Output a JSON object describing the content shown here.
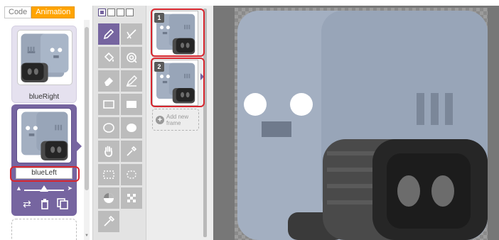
{
  "tabs": {
    "code": "Code",
    "animation": "Animation"
  },
  "animations": [
    {
      "name": "blueRight",
      "selected": false
    },
    {
      "name": "blueLeft",
      "selected": true
    }
  ],
  "speed": {
    "slow_icon": "turtle-icon",
    "fast_icon": "rabbit-icon",
    "level": 0.5
  },
  "card_actions": [
    "loop-icon",
    "trash-icon",
    "duplicate-icon"
  ],
  "tools": [
    "pencil-icon",
    "line-icon",
    "fill-bucket-icon",
    "lasso-select-icon",
    "eraser-icon",
    "pen-icon",
    "rectangle-outline-icon",
    "rectangle-filled-icon",
    "ellipse-outline-icon",
    "ellipse-filled-icon",
    "hand-icon",
    "eyedropper-icon",
    "rect-select-icon",
    "lasso-freeform-icon",
    "color-wheel-icon",
    "transparency-icon",
    "color-picker-icon"
  ],
  "brush_sizes": 4,
  "frames": [
    {
      "number": "1"
    },
    {
      "number": "2"
    }
  ],
  "add_frame_label": "Add new frame",
  "colors": {
    "accent_orange": "#ffa400",
    "accent_purple": "#7665a0",
    "highlight_red": "#d7262e",
    "robot_body": "#a3afc1",
    "robot_wheel": "#3a3a3a"
  }
}
